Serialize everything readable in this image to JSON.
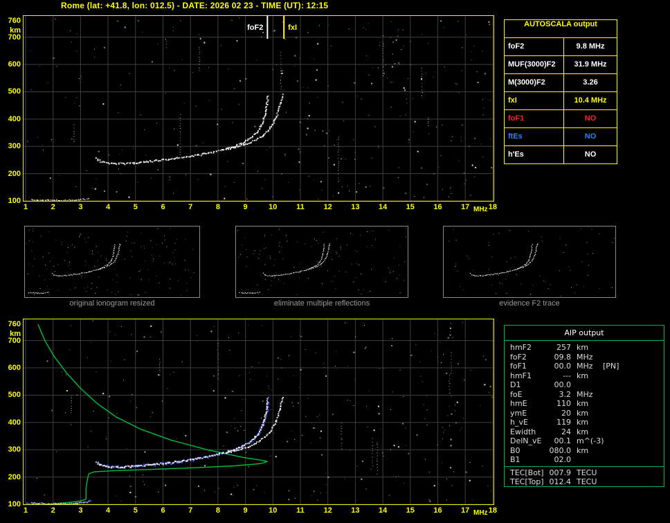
{
  "title": "Rome (lat: +41.8, lon: 012.5) - DATE: 2026 02 23 - TIME (UT): 12:15",
  "colors": {
    "background": "#000000",
    "frame_yellow": "#f0f000",
    "frame_green": "#00b450",
    "grid": "#3f3f3f",
    "trace_white": "#ffffff",
    "profile_green": "#00c83c",
    "fit_blue": "#3c55ff",
    "text_yellow": "#ffff00",
    "text_red": "#ff2020",
    "text_blue": "#2f7fff",
    "caption_gray": "#9a9a9a"
  },
  "autoscala_table": {
    "title": "AUTOSCALA output",
    "rows": [
      {
        "label": "foF2",
        "value": "9.8 MHz",
        "color": "#ffffff"
      },
      {
        "label": "MUF(3000)F2",
        "value": "31.9 MHz",
        "color": "#ffffff"
      },
      {
        "label": "M(3000)F2",
        "value": "3.26",
        "color": "#ffffff"
      },
      {
        "label": "fxI",
        "value": "10.4 MHz",
        "color": "#ffff00"
      },
      {
        "label": "foF1",
        "value": "NO",
        "color": "#ff2020"
      },
      {
        "label": "ftEs",
        "value": "NO",
        "color": "#2f7fff"
      },
      {
        "label": "h'Es",
        "value": "NO",
        "color": "#ffffff"
      }
    ]
  },
  "thumbnails": [
    {
      "caption": "original ionogram resized"
    },
    {
      "caption": "eliminate multiple reflections"
    },
    {
      "caption": "evidence F2 trace"
    }
  ],
  "aip_table": {
    "title": "AIP output",
    "rows": [
      {
        "label": "hmF2",
        "value": "257",
        "unit": "km",
        "note": ""
      },
      {
        "label": "foF2",
        "value": "09.8",
        "unit": "MHz",
        "note": ""
      },
      {
        "label": "foF1",
        "value": "00.0",
        "unit": "MHz",
        "note": "[PN]"
      },
      {
        "label": "hmF1",
        "value": "---",
        "unit": "km",
        "note": ""
      },
      {
        "label": "D1",
        "value": "00.0",
        "unit": "",
        "note": ""
      },
      {
        "label": "foE",
        "value": "3.2",
        "unit": "MHz",
        "note": ""
      },
      {
        "label": "hmE",
        "value": "110",
        "unit": "km",
        "note": ""
      },
      {
        "label": "ymE",
        "value": "20",
        "unit": "km",
        "note": ""
      },
      {
        "label": "h_vE",
        "value": "119",
        "unit": "km",
        "note": ""
      },
      {
        "label": "Ewidth",
        "value": "24",
        "unit": "km",
        "note": ""
      },
      {
        "label": "DelN_vE",
        "value": "00.1",
        "unit": "m^(-3)",
        "note": ""
      },
      {
        "label": "B0",
        "value": "080.0",
        "unit": "km",
        "note": ""
      },
      {
        "label": "B1",
        "value": "02.0",
        "unit": "",
        "note": ""
      }
    ],
    "tec_rows": [
      {
        "label": "TEC[Bot]",
        "value": "007.9",
        "unit": "TECU"
      },
      {
        "label": "TEC[Top]",
        "value": "012.4",
        "unit": "TECU"
      }
    ]
  },
  "chart_data": {
    "type": "scatter",
    "description": "Ionogram: virtual height (km) vs sounding frequency (MHz). Top panel: recorded echo traces with foF2/fxI markers. Bottom panel: same echoes plus Autoscala fitted trace (blue) and electron density profile (green).",
    "x_axis": {
      "label": "MHz",
      "range": [
        1,
        18
      ],
      "ticks": [
        1,
        2,
        3,
        4,
        5,
        6,
        7,
        8,
        9,
        10,
        11,
        12,
        13,
        14,
        15,
        16,
        17,
        18
      ]
    },
    "y_axis": {
      "label": "km",
      "range": [
        100,
        760
      ],
      "ticks": [
        760,
        700,
        600,
        500,
        400,
        300,
        200,
        100
      ]
    },
    "top_plot": {
      "annotations": [
        {
          "label": "foF2",
          "freq_mhz": 9.8,
          "color": "#ffffff"
        },
        {
          "label": "fxI",
          "freq_mhz": 10.4,
          "color": "#ffff00"
        }
      ],
      "series": [
        "e_layer_echo",
        "f2_ordinary_echo",
        "f2_extraordinary_echo"
      ]
    },
    "bottom_plot": {
      "series": [
        "e_layer_echo",
        "f2_ordinary_echo",
        "f2_extraordinary_echo",
        "fitted_e_trace",
        "fitted_f2_trace",
        "electron_density_profile"
      ]
    },
    "traces": {
      "e_layer_echo": {
        "color": "#ffffff",
        "points_mhz_km": [
          [
            1.2,
            106
          ],
          [
            1.5,
            105
          ],
          [
            1.9,
            104
          ],
          [
            2.3,
            104
          ],
          [
            2.7,
            105
          ],
          [
            3.0,
            107
          ],
          [
            3.2,
            109
          ],
          [
            3.35,
            114
          ]
        ]
      },
      "f2_ordinary_echo": {
        "color": "#ffffff",
        "points_mhz_km": [
          [
            3.55,
            258
          ],
          [
            3.7,
            247
          ],
          [
            3.9,
            241
          ],
          [
            4.2,
            238
          ],
          [
            4.6,
            239
          ],
          [
            5.0,
            242
          ],
          [
            5.4,
            246
          ],
          [
            5.8,
            250
          ],
          [
            6.2,
            255
          ],
          [
            6.6,
            260
          ],
          [
            7.0,
            266
          ],
          [
            7.4,
            273
          ],
          [
            7.8,
            281
          ],
          [
            8.2,
            291
          ],
          [
            8.6,
            304
          ],
          [
            9.0,
            322
          ],
          [
            9.3,
            344
          ],
          [
            9.5,
            368
          ],
          [
            9.62,
            395
          ],
          [
            9.7,
            425
          ],
          [
            9.76,
            458
          ],
          [
            9.8,
            492
          ]
        ]
      },
      "f2_extraordinary_echo": {
        "color": "#ffffff",
        "points_mhz_km": [
          [
            8.3,
            292
          ],
          [
            8.7,
            301
          ],
          [
            9.1,
            314
          ],
          [
            9.45,
            331
          ],
          [
            9.75,
            353
          ],
          [
            9.95,
            379
          ],
          [
            10.1,
            408
          ],
          [
            10.2,
            440
          ],
          [
            10.28,
            470
          ],
          [
            10.35,
            497
          ]
        ]
      },
      "fitted_e_trace": {
        "color": "#3c55ff",
        "points_mhz_km": [
          [
            1.0,
            104
          ],
          [
            1.6,
            104
          ],
          [
            2.2,
            104
          ],
          [
            2.8,
            106
          ],
          [
            3.2,
            110
          ],
          [
            3.4,
            116
          ]
        ]
      },
      "fitted_f2_trace": {
        "color": "#3c55ff",
        "points_mhz_km": [
          [
            3.6,
            252
          ],
          [
            3.8,
            243
          ],
          [
            4.1,
            239
          ],
          [
            4.6,
            240
          ],
          [
            5.2,
            244
          ],
          [
            5.8,
            249
          ],
          [
            6.4,
            256
          ],
          [
            7.0,
            264
          ],
          [
            7.6,
            275
          ],
          [
            8.2,
            289
          ],
          [
            8.7,
            306
          ],
          [
            9.1,
            326
          ],
          [
            9.4,
            352
          ],
          [
            9.6,
            385
          ],
          [
            9.72,
            425
          ],
          [
            9.78,
            462
          ],
          [
            9.82,
            500
          ]
        ]
      },
      "electron_density_profile": {
        "color": "#00c83c",
        "points_mhz_km": [
          [
            1.45,
            760
          ],
          [
            1.7,
            700
          ],
          [
            2.05,
            640
          ],
          [
            2.5,
            580
          ],
          [
            3.0,
            525
          ],
          [
            3.6,
            470
          ],
          [
            4.3,
            420
          ],
          [
            5.2,
            375
          ],
          [
            6.3,
            335
          ],
          [
            7.6,
            300
          ],
          [
            8.9,
            272
          ],
          [
            9.6,
            261
          ],
          [
            9.8,
            257
          ],
          [
            9.55,
            249
          ],
          [
            8.6,
            241
          ],
          [
            7.2,
            234
          ],
          [
            5.6,
            228
          ],
          [
            4.2,
            223
          ],
          [
            3.5,
            219
          ],
          [
            3.3,
            212
          ],
          [
            3.25,
            190
          ],
          [
            3.2,
            160
          ],
          [
            3.2,
            130
          ],
          [
            3.2,
            119
          ],
          [
            3.0,
            112
          ],
          [
            2.5,
            106
          ],
          [
            1.9,
            101
          ],
          [
            1.3,
            96
          ]
        ]
      }
    }
  }
}
